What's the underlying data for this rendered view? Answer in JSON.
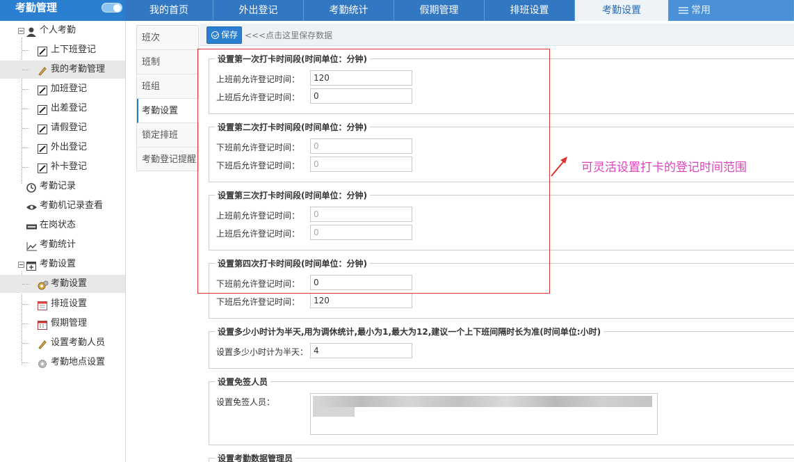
{
  "app": {
    "title": "考勤管理"
  },
  "tabs": [
    {
      "label": "我的首页"
    },
    {
      "label": "外出登记"
    },
    {
      "label": "考勤统计"
    },
    {
      "label": "假期管理"
    },
    {
      "label": "排班设置"
    },
    {
      "label": "考勤设置",
      "active": true
    },
    {
      "label": "常用",
      "icon": "menu-icon"
    }
  ],
  "sidebar": {
    "items": [
      {
        "label": "个人考勤",
        "icon": "user-icon",
        "level": 0,
        "expandable": true
      },
      {
        "label": "上下班登记",
        "icon": "edit-icon",
        "level": 1
      },
      {
        "label": "我的考勤管理",
        "icon": "pencil-icon",
        "level": 1,
        "highlighted": true
      },
      {
        "label": "加班登记",
        "icon": "edit-icon",
        "level": 1
      },
      {
        "label": "出差登记",
        "icon": "edit-icon",
        "level": 1
      },
      {
        "label": "请假登记",
        "icon": "edit-icon",
        "level": 1
      },
      {
        "label": "外出登记",
        "icon": "edit-icon",
        "level": 1
      },
      {
        "label": "补卡登记",
        "icon": "edit-icon",
        "level": 1
      },
      {
        "label": "考勤记录",
        "icon": "clock-icon",
        "level": 0
      },
      {
        "label": "考勤机记录查看",
        "icon": "eye-icon",
        "level": 0
      },
      {
        "label": "在岗状态",
        "icon": "card-icon",
        "level": 0
      },
      {
        "label": "考勤统计",
        "icon": "chart-line-icon",
        "level": 0
      },
      {
        "label": "考勤设置",
        "icon": "calendar-add-icon",
        "level": 0,
        "expandable": true
      },
      {
        "label": "考勤设置",
        "icon": "gears-icon",
        "level": 1,
        "highlighted": true
      },
      {
        "label": "排班设置",
        "icon": "calendar-icon",
        "level": 1
      },
      {
        "label": "假期管理",
        "icon": "calendar-grid-icon",
        "level": 1
      },
      {
        "label": "设置考勤人员",
        "icon": "pencil-icon",
        "level": 1
      },
      {
        "label": "考勤地点设置",
        "icon": "gear-icon",
        "level": 1
      }
    ]
  },
  "subnav": [
    {
      "label": "班次"
    },
    {
      "label": "班制"
    },
    {
      "label": "班组"
    },
    {
      "label": "考勤设置",
      "active": true
    },
    {
      "label": "锁定排班"
    },
    {
      "label": "考勤登记提醒"
    }
  ],
  "toolbar": {
    "save_label": "保存",
    "hint": "<<<点击这里保存数据"
  },
  "groups": [
    {
      "legend": "设置第一次打卡时间段(时间单位：分钟)",
      "fields": [
        {
          "label": "上班前允许登记时间：",
          "value": "120",
          "disabled": false
        },
        {
          "label": "上班后允许登记时间：",
          "value": "0",
          "disabled": false
        }
      ]
    },
    {
      "legend": "设置第二次打卡时间段(时间单位：分钟)",
      "fields": [
        {
          "label": "下班前允许登记时间：",
          "value": "0",
          "disabled": true
        },
        {
          "label": "下班后允许登记时间：",
          "value": "0",
          "disabled": true
        }
      ]
    },
    {
      "legend": "设置第三次打卡时间段(时间单位：分钟)",
      "fields": [
        {
          "label": "上班前允许登记时间：",
          "value": "0",
          "disabled": true
        },
        {
          "label": "上班后允许登记时间：",
          "value": "0",
          "disabled": true
        }
      ]
    },
    {
      "legend": "设置第四次打卡时间段(时间单位：分钟)",
      "fields": [
        {
          "label": "下班前允许登记时间：",
          "value": "0",
          "disabled": false
        },
        {
          "label": "下班后允许登记时间：",
          "value": "120",
          "disabled": false
        }
      ]
    },
    {
      "legend": "设置多少小时计为半天,用为调休统计,最小为1,最大为12,建议一个上下班间隔时长为准(时间单位:小时)",
      "fields": [
        {
          "label": "设置多少小时计为半天：",
          "value": "4",
          "disabled": false
        }
      ]
    },
    {
      "legend": "设置免签人员",
      "fields": [
        {
          "label": "设置免签人员：",
          "value": "",
          "disabled": false
        }
      ]
    },
    {
      "legend": "设置考勤数据管理员",
      "fields": []
    }
  ],
  "annotation": {
    "text": "可灵活设置打卡的登记时间范围",
    "color": "#e040c0"
  },
  "colors": {
    "header": "#2a7fd0",
    "highlight_frame": "#e03030"
  }
}
